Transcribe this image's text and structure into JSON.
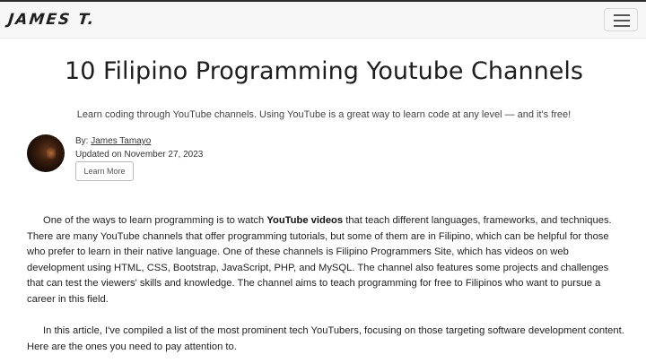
{
  "nav": {
    "brand": "JAMES T.",
    "menu_icon": "hamburger-menu-icon"
  },
  "article": {
    "title": "10 Filipino Programming Youtube Channels",
    "subtitle": "Learn coding through YouTube channels. Using YouTube is a great way to learn code at any level — and it's free!",
    "by_prefix": "By:",
    "author": "James Tamayo",
    "updated": "Updated on November 27, 2023",
    "learn_more": "Learn More",
    "p1_start": "One of the ways to learn programming is to watch ",
    "p1_bold": "YouTube videos",
    "p1_rest": " that teach different languages, frameworks, and techniques. There are many YouTube channels that offer programming tutorials, but some of them are in Filipino, which can be helpful for those who prefer to learn in their native language. One of these channels is Filipino Programmers Site, which has videos on web development using HTML, CSS, Bootstrap, JavaScript, PHP, and MySQL. The channel also features some projects and challenges that can test the viewers' skills and knowledge. The channel aims to teach programming for free to Filipinos who want to pursue a career in this field.",
    "p2": "In this article, I've compiled a list of the most prominent tech YouTubers, focusing on those targeting software development content. Here are the ones you need to pay attention to."
  }
}
